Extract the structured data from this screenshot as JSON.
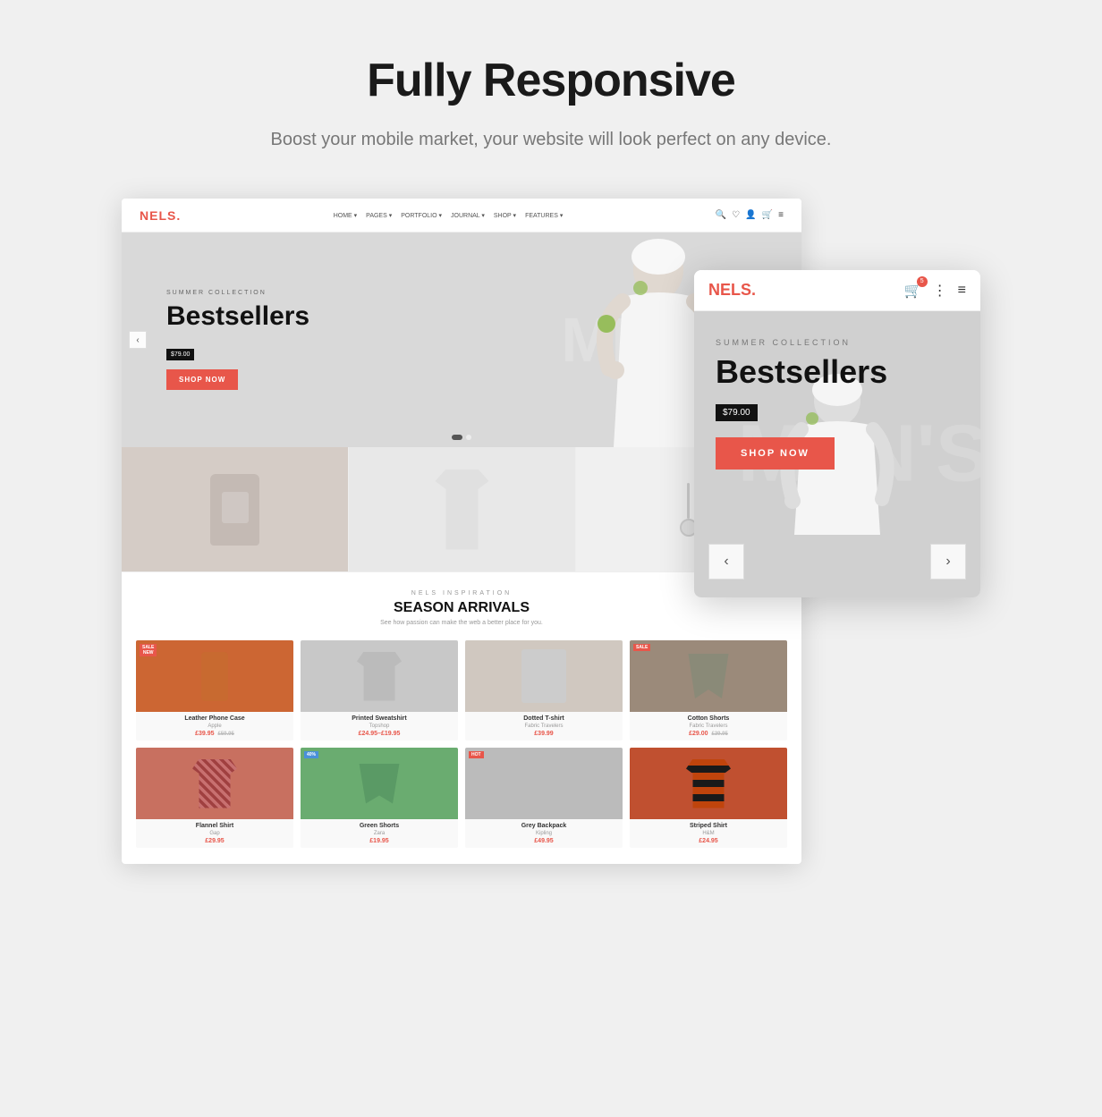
{
  "page": {
    "bg_color": "#f0f0f0"
  },
  "header": {
    "title": "Fully Responsive",
    "subtitle": "Boost your mobile market, your website will look perfect on any device."
  },
  "desktop_mockup": {
    "brand": "NELS",
    "brand_dot": ".",
    "nav_items": [
      "HOME ▾",
      "PAGES ▾",
      "PORTFOLIO ▾",
      "JOURNAL ▾",
      "SHOP ▾",
      "FEATURES ▾"
    ],
    "hero": {
      "tag": "SUMMER COLLECTION",
      "title": "Bestsellers",
      "bg_text": "MEN'S",
      "price": "$79.00",
      "shop_btn": "SHOP NOW",
      "dots": [
        true,
        false
      ],
      "left_arrow": "‹",
      "right_arrow": "›",
      "plus_btn": "+"
    },
    "categories": [
      "Bags",
      "Shirts",
      "Accessories"
    ],
    "season": {
      "label": "NELS INSPIRATION",
      "title": "SEASON ARRIVALS",
      "desc": "See how passion can make the web a better place for you."
    },
    "products_row1": [
      {
        "name": "Leather Phone Case",
        "brand": "Apple",
        "price": "£39.95",
        "old_price": "£59.95",
        "badge": "SALE",
        "badge_type": "sale"
      },
      {
        "name": "Printed Sweatshirt",
        "brand": "Topshop",
        "price": "£24.95–£19.95",
        "badge": "",
        "badge_type": ""
      },
      {
        "name": "Dotted T-shirt",
        "brand": "Fabric Travelers",
        "price": "£39.99",
        "badge": "",
        "badge_type": ""
      },
      {
        "name": "Cotton Shorts",
        "brand": "Fabric Travelers",
        "price": "£29.00",
        "old_price": "£39.95",
        "badge": "SALE",
        "badge_type": "sale"
      }
    ],
    "products_row2": [
      {
        "name": "Flannel Shirt",
        "brand": "Gap",
        "price": "£29.95",
        "badge": "",
        "badge_type": ""
      },
      {
        "name": "Green Shorts",
        "brand": "Zara",
        "price": "£19.95",
        "badge": "40%",
        "badge_type": "40"
      },
      {
        "name": "Grey Backpack",
        "brand": "Kipling",
        "price": "£49.95",
        "badge": "HOT",
        "badge_type": "hot"
      },
      {
        "name": "Striped Shirt",
        "brand": "H&M",
        "price": "£24.95",
        "badge": "",
        "badge_type": ""
      }
    ]
  },
  "mobile_mockup": {
    "brand": "NELS",
    "brand_dot": ".",
    "cart_count": "5",
    "hero": {
      "tag": "SUMMER COLLECTION",
      "title": "Bestsellers",
      "bg_text": "MEN'S",
      "price": "$79.00",
      "shop_btn": "SHOP NOW",
      "left_arrow": "‹",
      "right_arrow": "›"
    }
  }
}
